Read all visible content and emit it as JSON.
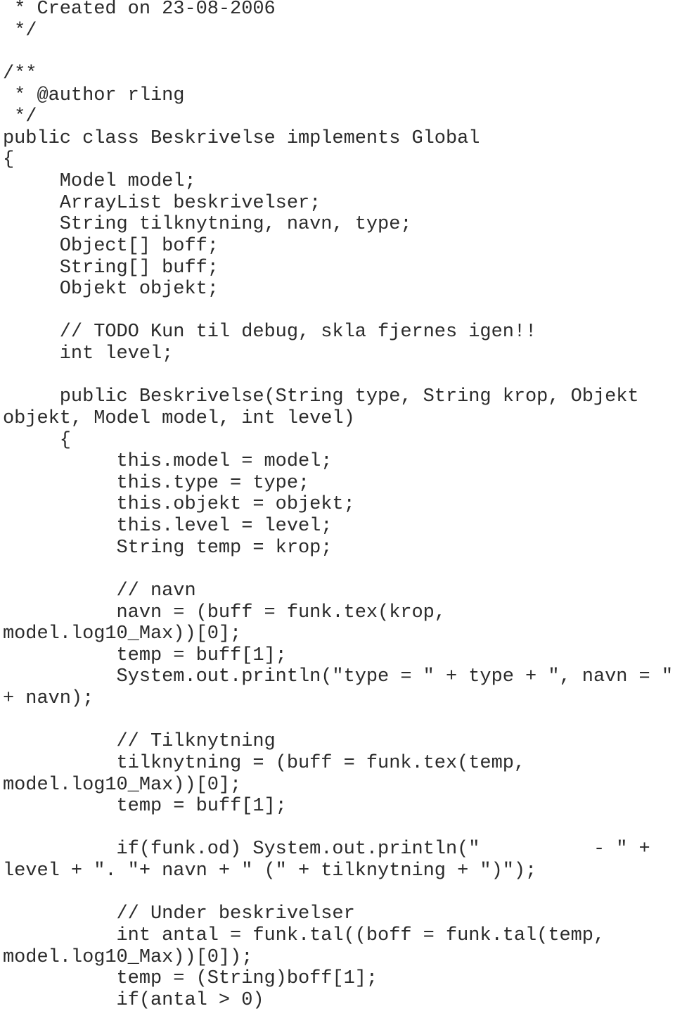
{
  "document": {
    "language": "Java",
    "lines": [
      " * Created on 23-08-2006",
      " */",
      "",
      "/**",
      " * @author rling",
      " */",
      "public class Beskrivelse implements Global",
      "{",
      "     Model model;",
      "     ArrayList beskrivelser;",
      "     String tilknytning, navn, type;",
      "     Object[] boff;",
      "     String[] buff;",
      "     Objekt objekt;",
      "",
      "     // TODO Kun til debug, skla fjernes igen!!",
      "     int level;",
      "",
      "     public Beskrivelse(String type, String krop, Objekt",
      "objekt, Model model, int level)",
      "     {",
      "          this.model = model;",
      "          this.type = type;",
      "          this.objekt = objekt;",
      "          this.level = level;",
      "          String temp = krop;",
      "",
      "          // navn",
      "          navn = (buff = funk.tex(krop,",
      "model.log10_Max))[0];",
      "          temp = buff[1];",
      "          System.out.println(\"type = \" + type + \", navn = \"",
      "+ navn);",
      "",
      "          // Tilknytning",
      "          tilknytning = (buff = funk.tex(temp,",
      "model.log10_Max))[0];",
      "          temp = buff[1];",
      "",
      "          if(funk.od) System.out.println(\"          - \" +",
      "level + \". \"+ navn + \" (\" + tilknytning + \")\");",
      "",
      "          // Under beskrivelser",
      "          int antal = funk.tal((boff = funk.tal(temp,",
      "model.log10_Max))[0]);",
      "          temp = (String)boff[1];",
      "          if(antal > 0)"
    ]
  }
}
